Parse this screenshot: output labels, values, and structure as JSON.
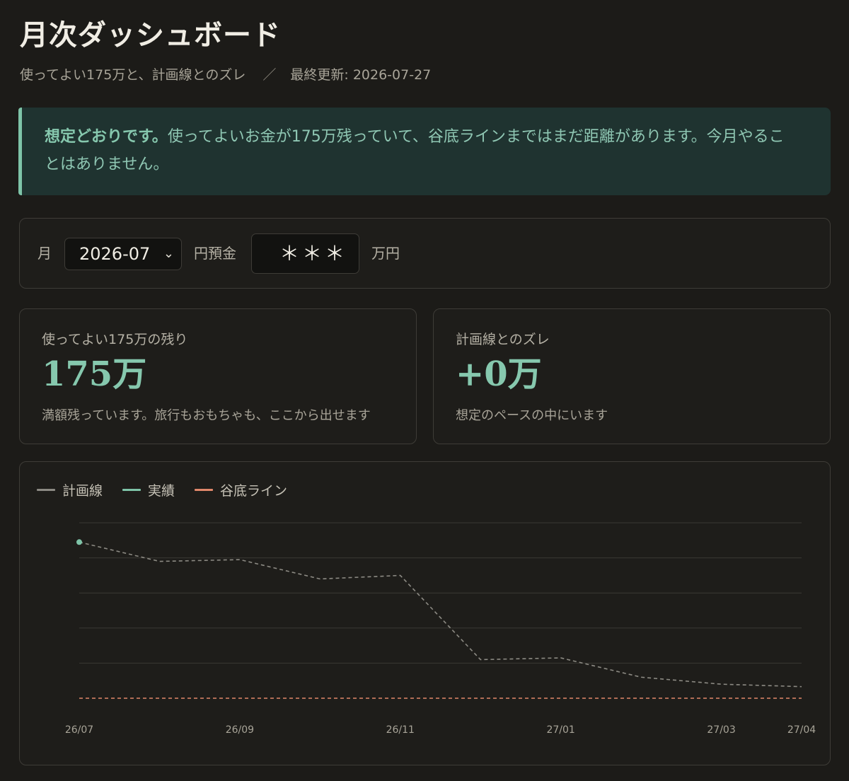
{
  "header": {
    "title": "月次ダッシュボード",
    "subtitle": "使ってよい175万と、計画線とのズレ",
    "separator": "／",
    "updated": "最終更新: 2026-07-27"
  },
  "notice": {
    "lead": "想定どおりです。",
    "body": "使ってよいお金が175万残っていて、谷底ラインまではまだ距離があります。今月やることはありません。"
  },
  "controls": {
    "month_label": "月",
    "month_value": "2026-07",
    "deposit_label": "円預金",
    "deposit_value": "＊＊＊",
    "deposit_unit": "万円"
  },
  "stats": [
    {
      "label": "使ってよい175万の残り",
      "value": "175万",
      "note": "満額残っています。旅行もおもちゃも、ここから出せます"
    },
    {
      "label": "計画線とのズレ",
      "value": "+0万",
      "note": "想定のペースの中にいます"
    }
  ],
  "chart_legend": [
    {
      "name": "計画線",
      "color": "#8c8a83"
    },
    {
      "name": "実績",
      "color": "#7ec4a8"
    },
    {
      "name": "谷底ライン",
      "color": "#e0876b"
    }
  ],
  "chart_data": {
    "type": "line",
    "x_tick_labels": [
      "26/07",
      "26/09",
      "26/11",
      "27/01",
      "27/03",
      "27/04"
    ],
    "x": [
      "26/07",
      "26/08",
      "26/09",
      "26/10",
      "26/11",
      "26/12",
      "27/01",
      "27/02",
      "27/03",
      "27/04"
    ],
    "ylim": [
      0,
      5
    ],
    "grid": true,
    "legend": "top-left",
    "series": [
      {
        "name": "計画線",
        "style": "dashed",
        "color": "#8c8a83",
        "values": [
          4.45,
          3.9,
          3.95,
          3.4,
          3.5,
          1.1,
          1.15,
          0.6,
          0.4,
          0.33
        ]
      },
      {
        "name": "実績",
        "style": "point",
        "color": "#7ec4a8",
        "values": [
          4.45
        ]
      },
      {
        "name": "谷底ライン",
        "style": "dashed",
        "color": "#e0876b",
        "values": [
          0,
          0,
          0,
          0,
          0,
          0,
          0,
          0,
          0,
          0
        ]
      }
    ]
  }
}
